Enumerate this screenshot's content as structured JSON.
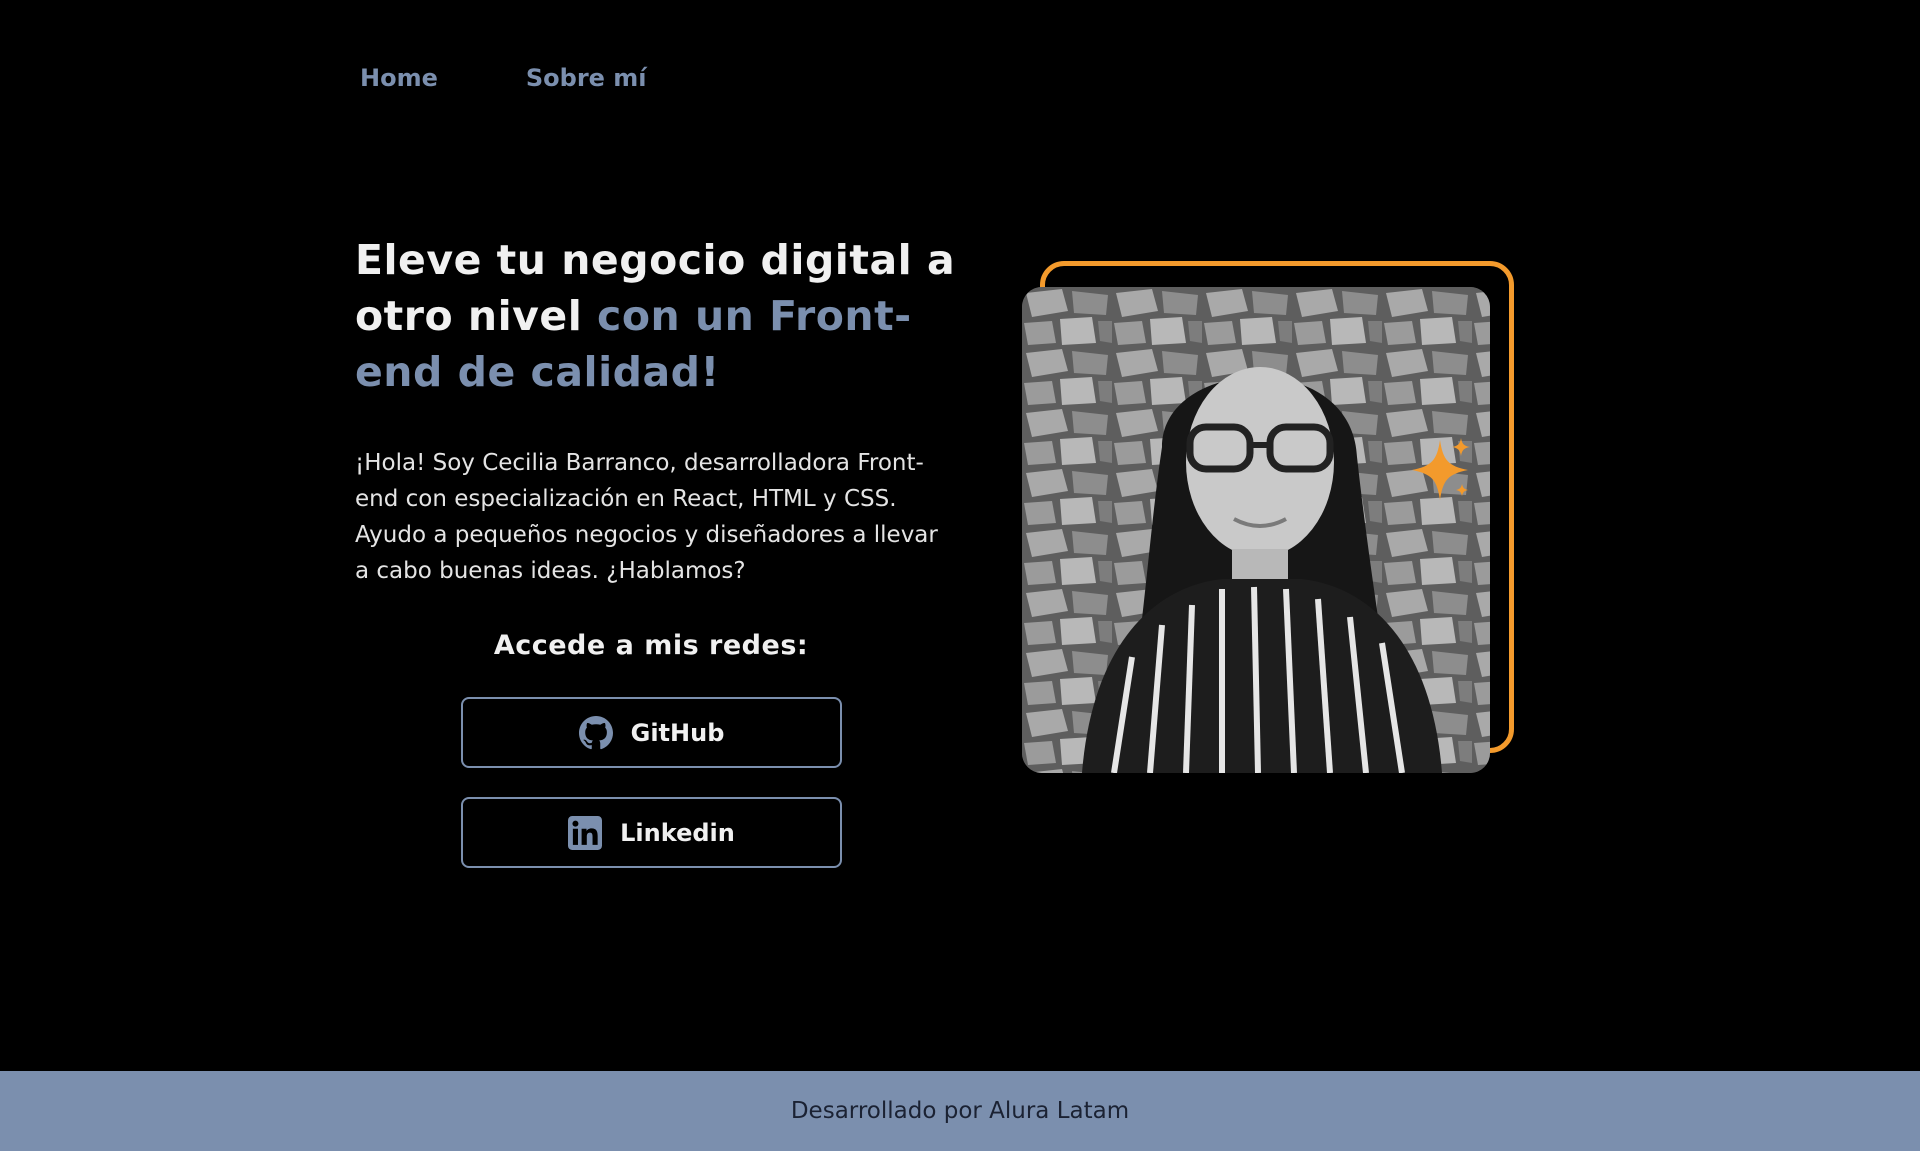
{
  "nav": {
    "items": [
      {
        "label": "Home"
      },
      {
        "label": "Sobre mí"
      }
    ]
  },
  "hero": {
    "title_part1": "Eleve tu negocio digital a otro nivel ",
    "title_accent": "con un Front-end de calidad!",
    "intro": "¡Hola! Soy Cecilia Barranco, desarrolladora Front-end con especialización en React, HTML y CSS. Ayudo a pequeños negocios y diseñadores a llevar a cabo buenas ideas. ¿Hablamos?"
  },
  "social": {
    "heading": "Accede a mis redes:",
    "buttons": [
      {
        "label": "GitHub",
        "icon": "github-icon"
      },
      {
        "label": "Linkedin",
        "icon": "linkedin-icon"
      }
    ]
  },
  "profile": {
    "photo": "portrait-photo",
    "decoration": "sparkle-icon"
  },
  "footer": {
    "text": "Desarrollado por Alura Latam"
  },
  "colors": {
    "background": "#000000",
    "accent_blue": "#7B8FAE",
    "accent_orange": "#F39A2C",
    "text_light": "#F0F0F0",
    "footer_text": "#1B2233"
  }
}
